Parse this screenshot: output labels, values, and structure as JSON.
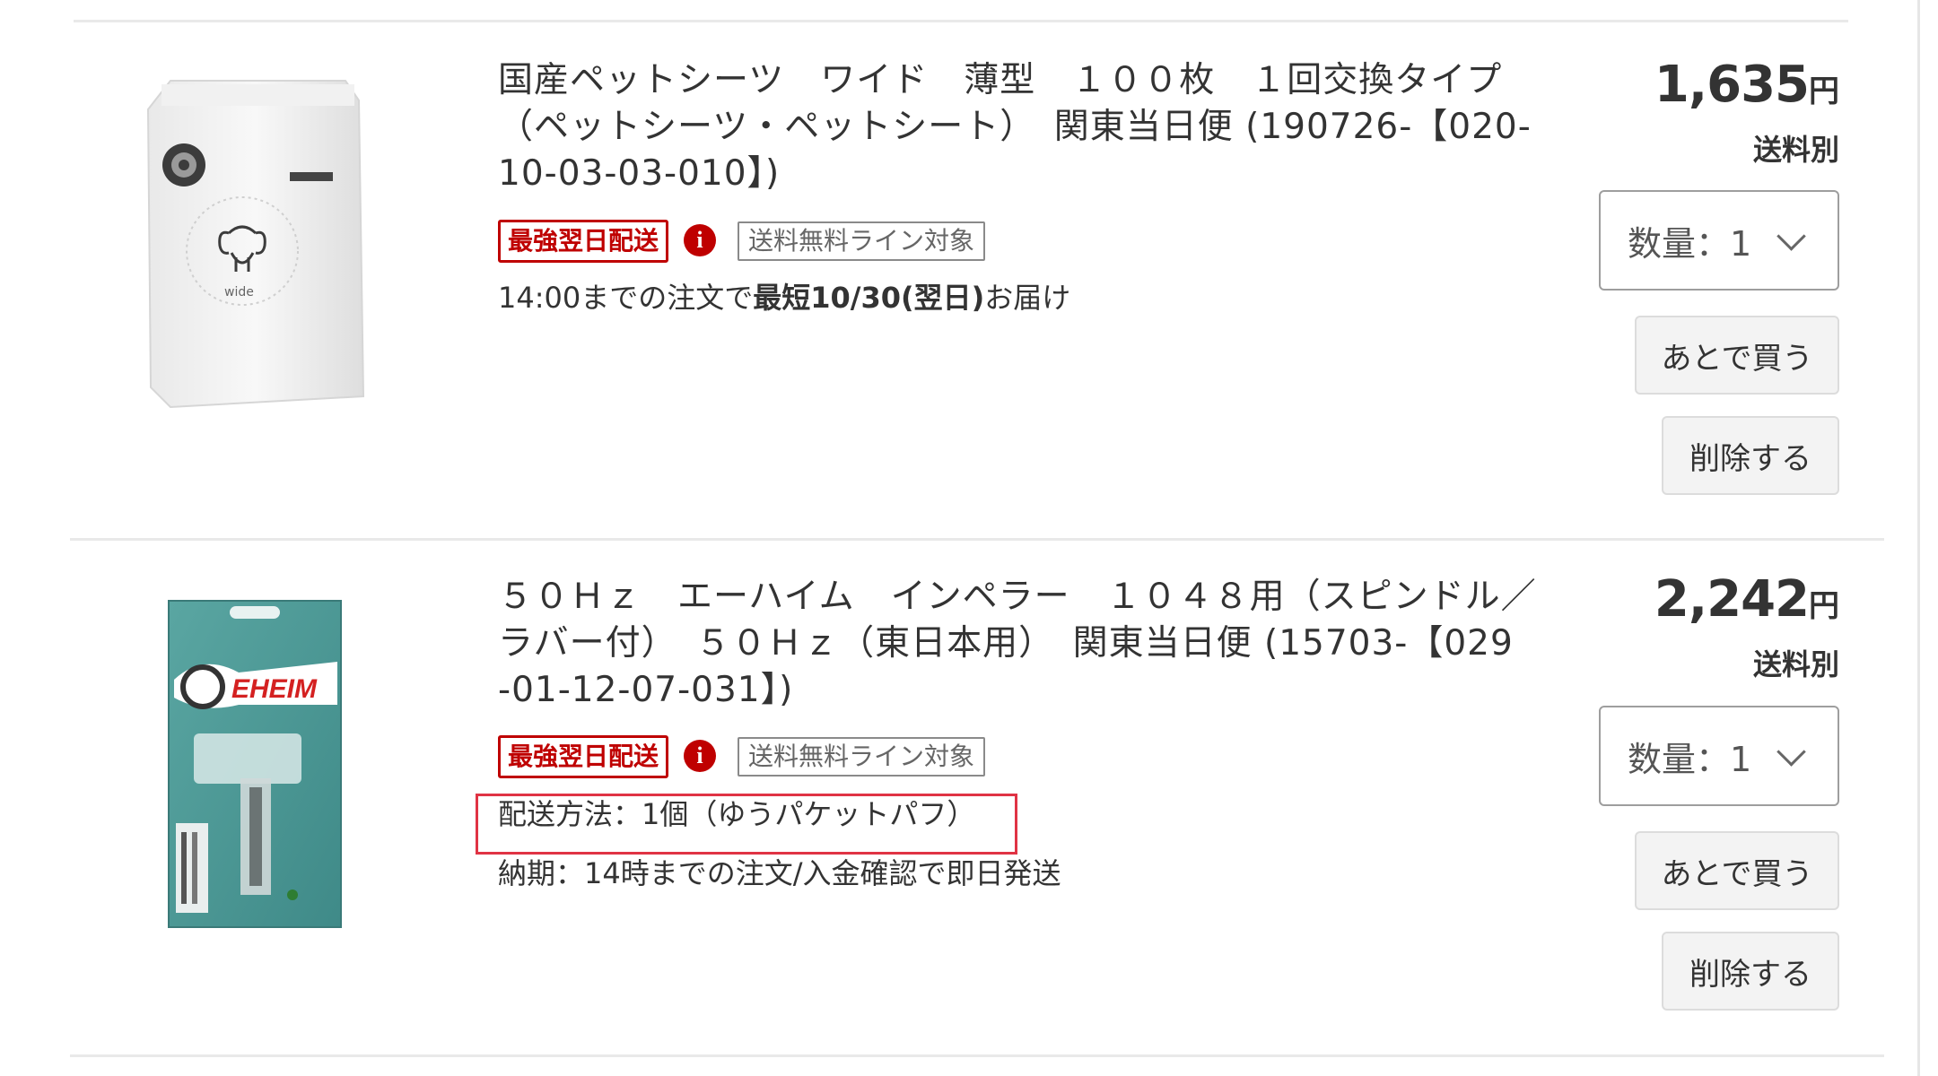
{
  "items": [
    {
      "title_lines": [
        "国産ペットシーツ　ワイド　薄型　１００枚　１回交換タイプ",
        "（ペットシーツ・ペットシート）　関東当日便 (190726-【020-",
        "10-03-03-010】)"
      ],
      "badge_next_day": "最強翌日配送",
      "info_icon": "i",
      "badge_free_shipping": "送料無料ライン対象",
      "delivery_prefix": "14:00までの注文で",
      "delivery_bold": "最短10/30(翌日)",
      "delivery_suffix": "お届け",
      "price": "1,635",
      "price_unit": "円",
      "shipping": "送料別",
      "quantity_label": "数量：1",
      "save_later_label": "あとで買う",
      "delete_label": "削除する",
      "image_caption": "wide"
    },
    {
      "title_lines": [
        "５０Ｈｚ　エーハイム　インペラー　１０４８用（スピンドル／",
        "ラバー付）　５０Ｈｚ（東日本用）　関東当日便 (15703-【029",
        "-01-12-07-031】)"
      ],
      "badge_next_day": "最強翌日配送",
      "info_icon": "i",
      "badge_free_shipping": "送料無料ライン対象",
      "shipping_method": "配送方法：1個（ゆうパケットパフ）",
      "lead_time": "納期：14時までの注文/入金確認で即日発送",
      "price": "2,242",
      "price_unit": "円",
      "shipping": "送料別",
      "quantity_label": "数量：1",
      "save_later_label": "あとで買う",
      "delete_label": "削除する",
      "image_brand": "EHEIM"
    }
  ],
  "colors": {
    "accent_red": "#bf0000",
    "highlight_red": "#e03344",
    "text": "#333333",
    "teal_package": "#4f9a97"
  }
}
